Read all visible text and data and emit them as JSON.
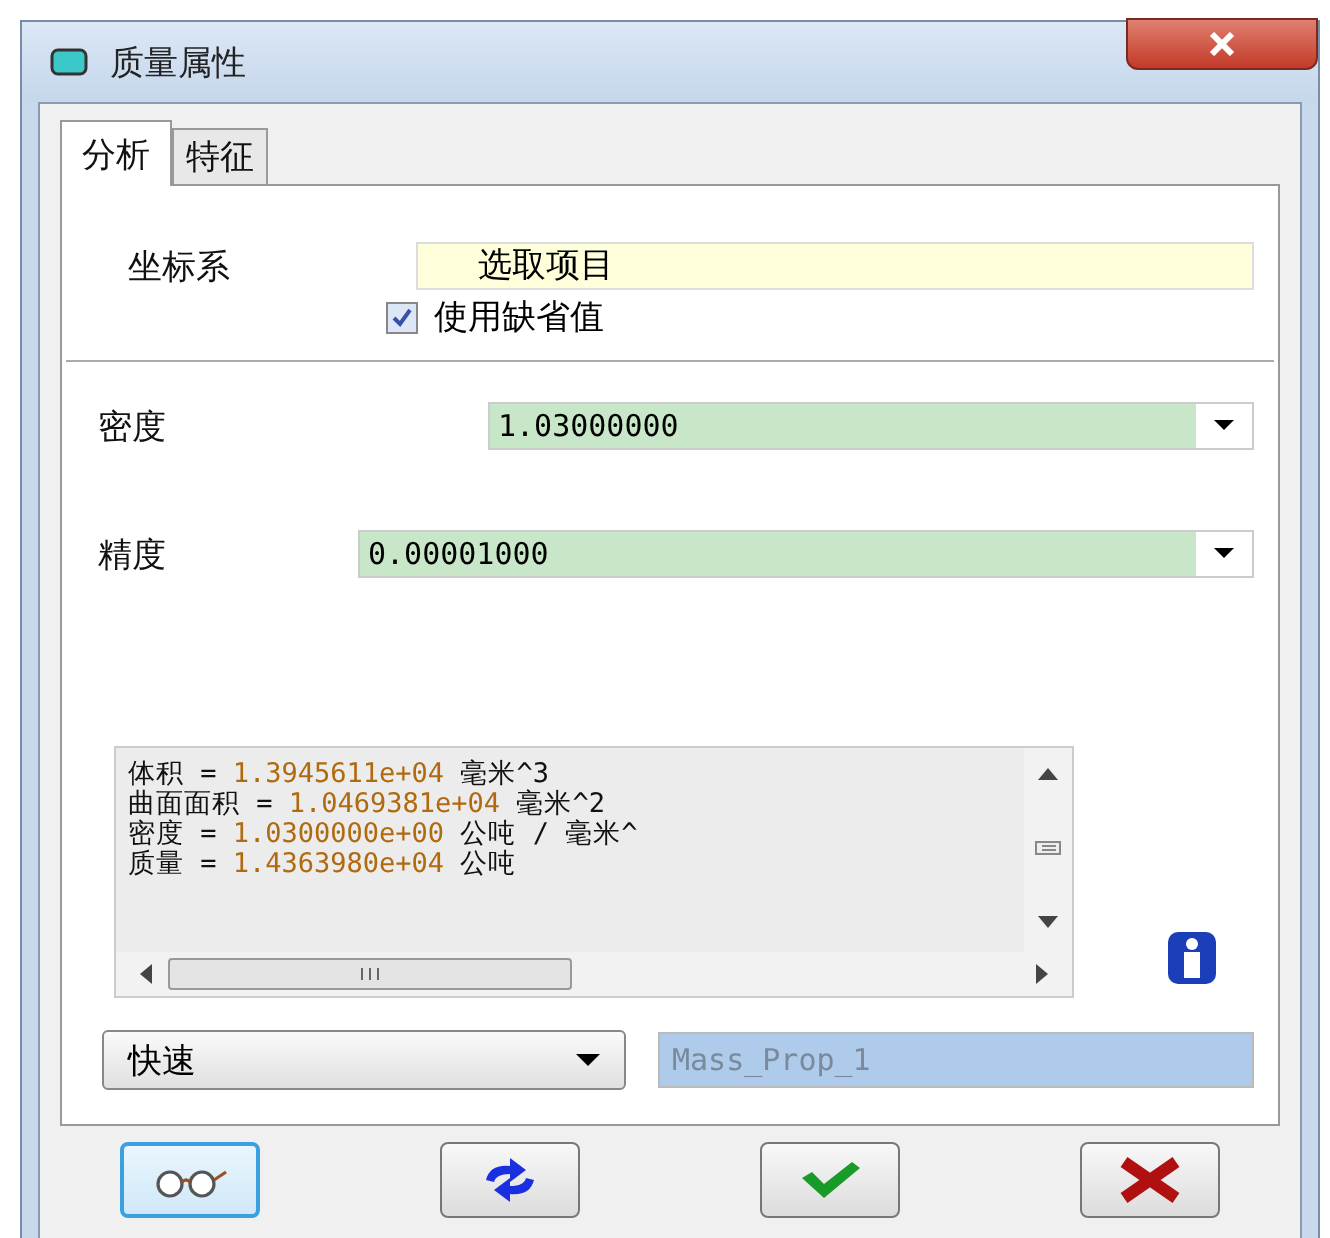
{
  "window": {
    "title": "质量属性"
  },
  "tabs": [
    {
      "label": "分析",
      "selected": true
    },
    {
      "label": "特征",
      "selected": false
    }
  ],
  "coordinate_system": {
    "label": "坐标系",
    "value": "选取项目"
  },
  "use_default": {
    "label": "使用缺省值",
    "checked": true
  },
  "density": {
    "label": "密度",
    "value": "1.03000000"
  },
  "accuracy": {
    "label": "精度",
    "value": "0.00001000"
  },
  "results": [
    {
      "name": "体积 = ",
      "value": "1.3945611e+04",
      "unit": " 毫米^3"
    },
    {
      "name": "曲面面积 = ",
      "value": "1.0469381e+04",
      "unit": " 毫米^2"
    },
    {
      "name": "密度 = ",
      "value": "1.0300000e+00",
      "unit": " 公吨 / 毫米^"
    },
    {
      "name": "质量 = ",
      "value": "1.4363980e+04",
      "unit": " 公吨"
    }
  ],
  "mode": {
    "value": "快速"
  },
  "feature_name": {
    "value": "Mass_Prop_1"
  },
  "buttons": [
    {
      "kind": "preview",
      "focused": true
    },
    {
      "kind": "recompute",
      "focused": false
    },
    {
      "kind": "ok",
      "focused": false
    },
    {
      "kind": "cancel",
      "focused": false
    }
  ]
}
